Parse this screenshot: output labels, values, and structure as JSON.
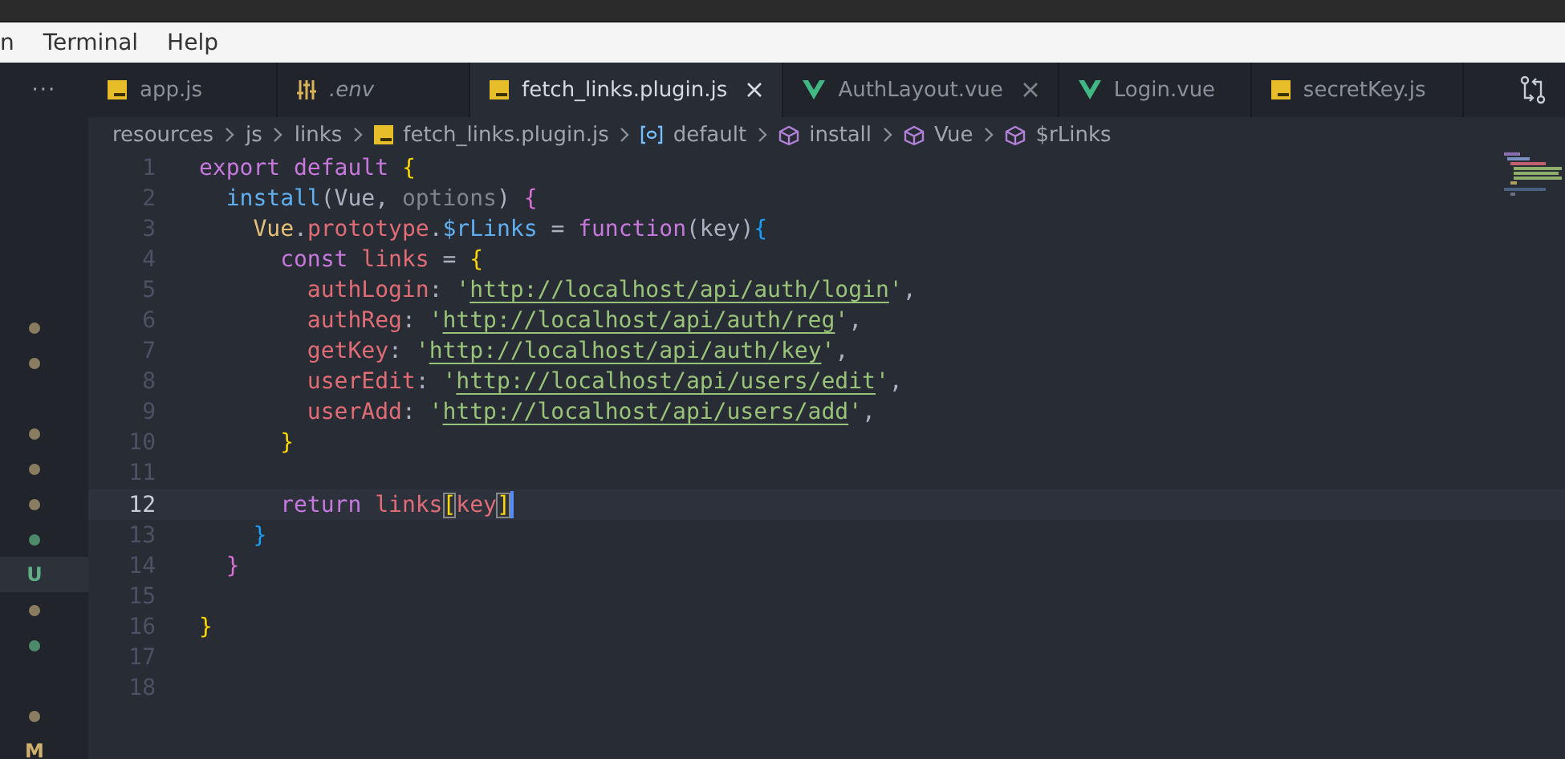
{
  "menu_bar": {
    "items": [
      "n",
      "Terminal",
      "Help"
    ]
  },
  "sidebar": {
    "items": [
      {
        "kind": "empty",
        "selected": false
      },
      {
        "kind": "empty",
        "selected": false
      },
      {
        "kind": "empty",
        "selected": false
      },
      {
        "kind": "empty",
        "selected": false
      },
      {
        "kind": "empty",
        "selected": false
      },
      {
        "kind": "dot",
        "color": "#8a7c60",
        "selected": false
      },
      {
        "kind": "dot",
        "color": "#8a7c60",
        "selected": false
      },
      {
        "kind": "empty",
        "selected": false
      },
      {
        "kind": "dot",
        "color": "#8a7c60",
        "selected": false
      },
      {
        "kind": "dot",
        "color": "#8a7c60",
        "selected": false
      },
      {
        "kind": "dot",
        "color": "#8a7c60",
        "selected": false
      },
      {
        "kind": "dot",
        "color": "#4d8a6a",
        "selected": false
      },
      {
        "kind": "letter",
        "text": "U",
        "color": "#5fae85",
        "selected": true
      },
      {
        "kind": "dot",
        "color": "#8a7c60",
        "selected": false
      },
      {
        "kind": "dot",
        "color": "#4d8a6a",
        "selected": false
      },
      {
        "kind": "empty",
        "selected": false
      },
      {
        "kind": "dot",
        "color": "#8a7c60",
        "selected": false
      },
      {
        "kind": "letter",
        "text": "M",
        "color": "#d1b06e",
        "selected": false
      }
    ]
  },
  "tabs": {
    "overflow": "···",
    "items": [
      {
        "label": "app.js",
        "kind": "js",
        "selected": false,
        "preview": false,
        "close": false
      },
      {
        "label": ".env",
        "kind": "env",
        "selected": false,
        "preview": true,
        "close": false
      },
      {
        "label": "fetch_links.plugin.js",
        "kind": "js",
        "selected": true,
        "preview": false,
        "close": true
      },
      {
        "label": "AuthLayout.vue",
        "kind": "vue",
        "selected": false,
        "preview": false,
        "close": true
      },
      {
        "label": "Login.vue",
        "kind": "vue",
        "selected": false,
        "preview": false,
        "close": false
      },
      {
        "label": "secretKey.js",
        "kind": "js",
        "selected": false,
        "preview": false,
        "close": false
      }
    ]
  },
  "breadcrumbs": [
    {
      "label": "resources",
      "kind": "folder"
    },
    {
      "label": "js",
      "kind": "folder"
    },
    {
      "label": "links",
      "kind": "folder"
    },
    {
      "label": "fetch_links.plugin.js",
      "kind": "js"
    },
    {
      "label": "default",
      "kind": "variable"
    },
    {
      "label": "install",
      "kind": "module"
    },
    {
      "label": "Vue",
      "kind": "module"
    },
    {
      "label": "$rLinks",
      "kind": "module"
    }
  ],
  "editor": {
    "lines": [
      {
        "number": "1",
        "current": false,
        "tokens": [
          {
            "kind": "keyword",
            "text": "export"
          },
          {
            "kind": "keyword",
            "text": " default"
          },
          {
            "kind": "brace1",
            "text": " {"
          }
        ]
      },
      {
        "number": "2",
        "current": false,
        "tokens": [
          {
            "kind": "func",
            "text": "  install"
          },
          {
            "kind": "plain",
            "text": "(Vue, "
          },
          {
            "kind": "param",
            "text": "options"
          },
          {
            "kind": "plain",
            "text": ") "
          },
          {
            "kind": "brace2",
            "text": "{"
          }
        ]
      },
      {
        "number": "3",
        "current": false,
        "tokens": [
          {
            "kind": "class",
            "text": "    Vue"
          },
          {
            "kind": "plain",
            "text": "."
          },
          {
            "kind": "prop",
            "text": "prototype"
          },
          {
            "kind": "plain",
            "text": "."
          },
          {
            "kind": "func",
            "text": "$rLinks"
          },
          {
            "kind": "plain",
            "text": " = "
          },
          {
            "kind": "keyword",
            "text": "function"
          },
          {
            "kind": "plain",
            "text": "(key)"
          },
          {
            "kind": "brace3",
            "text": "{"
          }
        ]
      },
      {
        "number": "4",
        "current": false,
        "tokens": [
          {
            "kind": "keyword",
            "text": "      const"
          },
          {
            "kind": "prop",
            "text": " links"
          },
          {
            "kind": "plain",
            "text": " = "
          },
          {
            "kind": "brace1",
            "text": "{"
          }
        ]
      },
      {
        "number": "5",
        "current": false,
        "tokens": [
          {
            "kind": "prop",
            "text": "        authLogin"
          },
          {
            "kind": "plain",
            "text": ": "
          },
          {
            "kind": "string",
            "text": "'"
          },
          {
            "kind": "link",
            "text": "http://localhost/api/auth/login"
          },
          {
            "kind": "string",
            "text": "'"
          },
          {
            "kind": "plain",
            "text": ","
          }
        ]
      },
      {
        "number": "6",
        "current": false,
        "tokens": [
          {
            "kind": "prop",
            "text": "        authReg"
          },
          {
            "kind": "plain",
            "text": ": "
          },
          {
            "kind": "string",
            "text": "'"
          },
          {
            "kind": "link",
            "text": "http://localhost/api/auth/reg"
          },
          {
            "kind": "string",
            "text": "'"
          },
          {
            "kind": "plain",
            "text": ","
          }
        ]
      },
      {
        "number": "7",
        "current": false,
        "tokens": [
          {
            "kind": "prop",
            "text": "        getKey"
          },
          {
            "kind": "plain",
            "text": ": "
          },
          {
            "kind": "string",
            "text": "'"
          },
          {
            "kind": "link",
            "text": "http://localhost/api/auth/key"
          },
          {
            "kind": "string",
            "text": "'"
          },
          {
            "kind": "plain",
            "text": ","
          }
        ]
      },
      {
        "number": "8",
        "current": false,
        "tokens": [
          {
            "kind": "prop",
            "text": "        userEdit"
          },
          {
            "kind": "plain",
            "text": ": "
          },
          {
            "kind": "string",
            "text": "'"
          },
          {
            "kind": "link",
            "text": "http://localhost/api/users/edit"
          },
          {
            "kind": "string",
            "text": "'"
          },
          {
            "kind": "plain",
            "text": ","
          }
        ]
      },
      {
        "number": "9",
        "current": false,
        "tokens": [
          {
            "kind": "prop",
            "text": "        userAdd"
          },
          {
            "kind": "plain",
            "text": ": "
          },
          {
            "kind": "string",
            "text": "'"
          },
          {
            "kind": "link",
            "text": "http://localhost/api/users/add"
          },
          {
            "kind": "string",
            "text": "'"
          },
          {
            "kind": "plain",
            "text": ","
          }
        ]
      },
      {
        "number": "10",
        "current": false,
        "tokens": [
          {
            "kind": "brace1",
            "text": "      }"
          }
        ]
      },
      {
        "number": "11",
        "current": false
      },
      {
        "number": "12",
        "current": true,
        "tokens": [
          {
            "kind": "keyword",
            "text": "      return"
          },
          {
            "kind": "prop",
            "text": " links"
          },
          {
            "kind": "match",
            "text": "["
          },
          {
            "kind": "prop",
            "text": "key"
          },
          {
            "kind": "match",
            "text": "]"
          }
        ]
      },
      {
        "number": "13",
        "current": false,
        "tokens": [
          {
            "kind": "brace3",
            "text": "    }"
          }
        ]
      },
      {
        "number": "14",
        "current": false,
        "tokens": [
          {
            "kind": "brace2",
            "text": "  }"
          }
        ]
      },
      {
        "number": "15",
        "current": false
      },
      {
        "number": "16",
        "current": false,
        "tokens": [
          {
            "kind": "brace1",
            "text": "}"
          }
        ]
      },
      {
        "number": "17",
        "current": false
      },
      {
        "number": "18",
        "current": false
      }
    ]
  }
}
